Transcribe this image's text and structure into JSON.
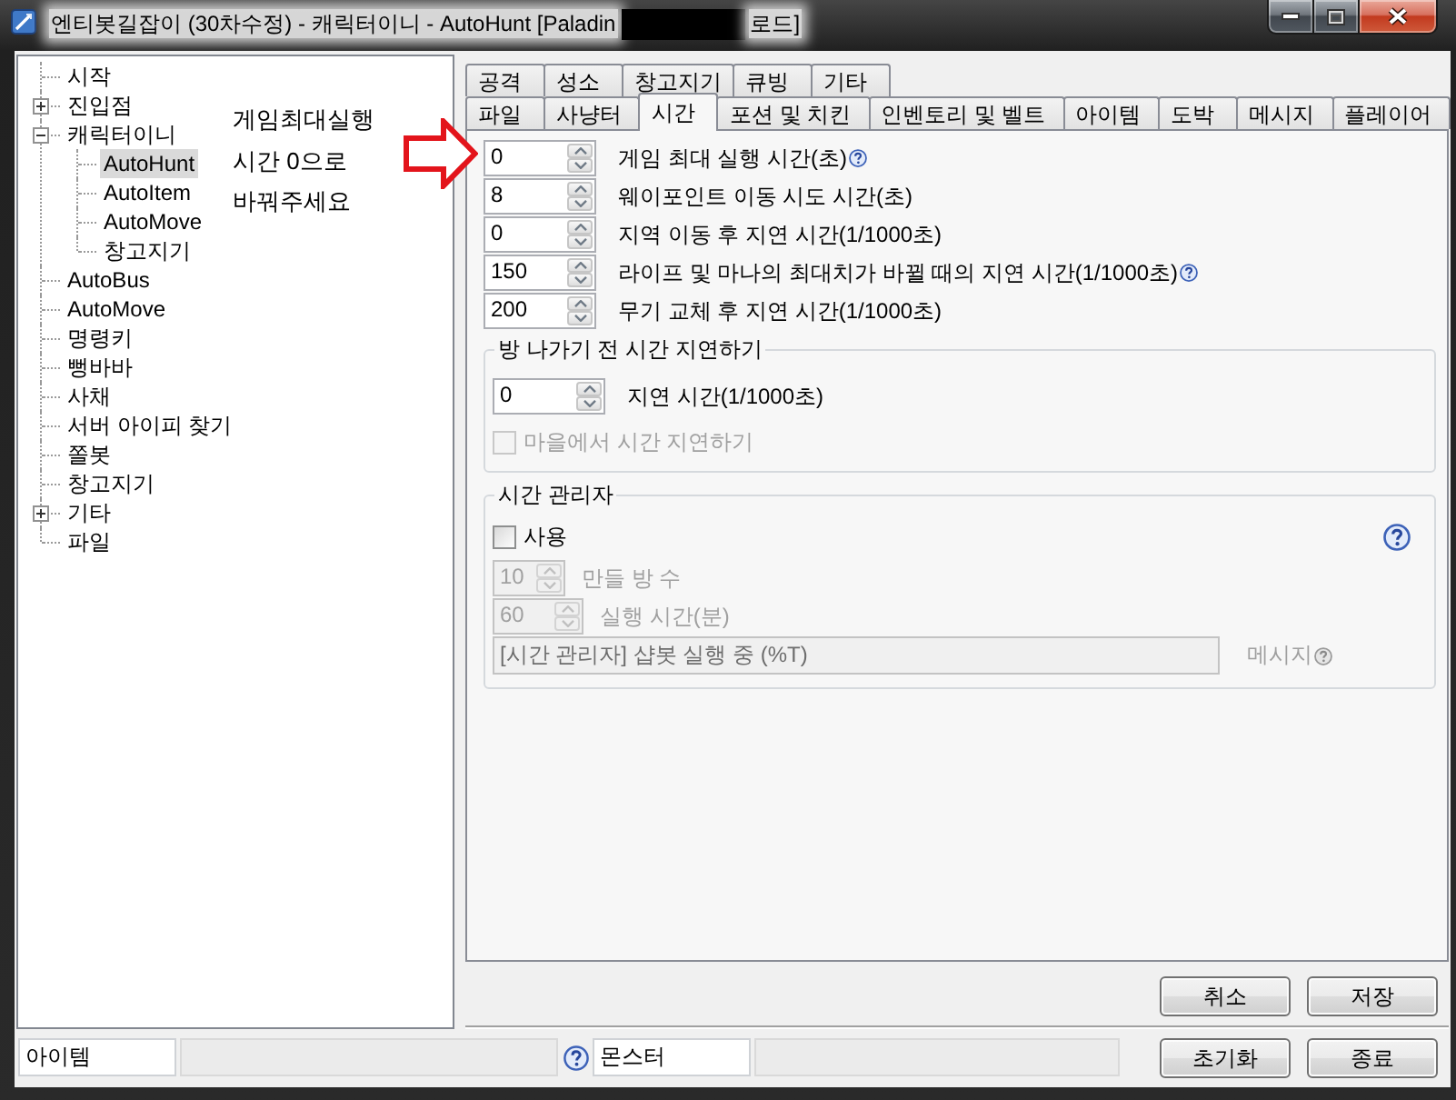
{
  "window": {
    "title": "엔티봇길잡이 (30차수정) - 캐릭터이니 - AutoHunt [Paladin",
    "redacted": true,
    "title_tail": "로드]"
  },
  "tree": [
    {
      "label": "시작",
      "selected": false
    },
    {
      "label": "진입점",
      "selected": false,
      "expanded": false
    },
    {
      "label": "캐릭터이니",
      "selected": false,
      "expanded": true,
      "children": [
        {
          "label": "AutoHunt",
          "selected": true
        },
        {
          "label": "AutoItem",
          "selected": false
        },
        {
          "label": "AutoMove",
          "selected": false
        },
        {
          "label": "창고지기",
          "selected": false
        }
      ]
    },
    {
      "label": "AutoBus",
      "selected": false
    },
    {
      "label": "AutoMove",
      "selected": false
    },
    {
      "label": "명령키",
      "selected": false
    },
    {
      "label": "뻥바바",
      "selected": false
    },
    {
      "label": "사채",
      "selected": false
    },
    {
      "label": "서버 아이피 찾기",
      "selected": false
    },
    {
      "label": "쫄봇",
      "selected": false
    },
    {
      "label": "창고지기",
      "selected": false
    },
    {
      "label": "기타",
      "selected": false,
      "expanded": false
    },
    {
      "label": "파일",
      "selected": false
    }
  ],
  "annotation": {
    "lines": [
      "게임최대실행",
      "시간 0으로",
      "바꿔주세요"
    ]
  },
  "tabs": [
    [
      {
        "label": "공격",
        "selected": false
      },
      {
        "label": "성소",
        "selected": false
      },
      {
        "label": "창고지기",
        "selected": false
      },
      {
        "label": "큐빙",
        "selected": false
      },
      {
        "label": "기타",
        "selected": false
      }
    ],
    [
      {
        "label": "파일",
        "selected": false
      },
      {
        "label": "사냥터",
        "selected": false
      },
      {
        "label": "시간",
        "selected": true
      },
      {
        "label": "포션 및 치킨",
        "selected": false
      },
      {
        "label": "인벤토리 및 벨트",
        "selected": false
      },
      {
        "label": "아이템",
        "selected": false
      },
      {
        "label": "도박",
        "selected": false
      },
      {
        "label": "메시지",
        "selected": false
      },
      {
        "label": "플레이어",
        "selected": false
      }
    ]
  ],
  "settings": [
    {
      "value": "0",
      "label": "게임 최대 실행 시간(초)",
      "help": true
    },
    {
      "value": "8",
      "label": "웨이포인트 이동 시도 시간(초)",
      "help": false
    },
    {
      "value": "0",
      "label": "지역 이동 후 지연 시간(1/1000초)",
      "help": false
    },
    {
      "value": "150",
      "label": "라이프 및 마나의 최대치가 바뀔 때의 지연 시간(1/1000초)",
      "help": true
    },
    {
      "value": "200",
      "label": "무기 교체 후 지연 시간(1/1000초)",
      "help": false
    }
  ],
  "room_delay": {
    "title": "방 나가기 전 시간 지연하기",
    "field": {
      "value": "0",
      "label": "지연 시간(1/1000초)"
    },
    "checkbox": {
      "label": "마을에서 시간 지연하기",
      "checked": false,
      "disabled": true
    }
  },
  "time_manager": {
    "title": "시간 관리자",
    "checkbox": {
      "label": "사용",
      "checked": false,
      "disabled": false
    },
    "help": true,
    "fields": [
      {
        "value": "10",
        "label": "만들 방 수",
        "disabled": true
      },
      {
        "value": "60",
        "label": "실행 시간(분)",
        "disabled": true
      }
    ],
    "message": {
      "value": "[시간 관리자] 샵봇 실행 중 (%T)",
      "label": "메시지",
      "help": true,
      "disabled": true
    }
  },
  "buttons": [
    "취소",
    "저장"
  ],
  "status_bar": [
    {
      "label": "아이템",
      "help": false
    },
    {
      "label": "몬스터",
      "help": true
    }
  ],
  "footer_buttons": [
    "초기화",
    "종료"
  ]
}
